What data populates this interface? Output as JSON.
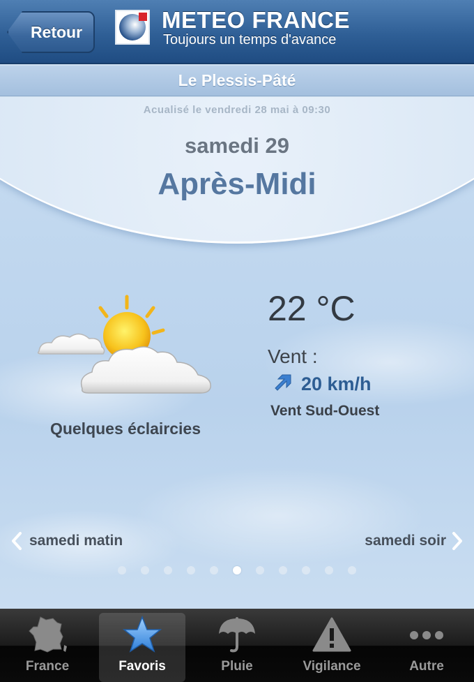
{
  "header": {
    "back_label": "Retour",
    "brand_title": "METEO FRANCE",
    "brand_tagline": "Toujours un temps d'avance"
  },
  "city": "Le Plessis-Pâté",
  "updated": "Acualisé le vendredi 28 mai à 09:30",
  "forecast": {
    "day": "samedi 29",
    "period": "Après-Midi",
    "condition": "Quelques éclaircies",
    "condition_icon": "sun-behind-clouds-icon",
    "temperature": "22 °C",
    "wind_label": "Vent :",
    "wind_speed": "20 km/h",
    "wind_direction": "Vent Sud-Ouest",
    "wind_arrow_icon": "arrow-north-east-icon"
  },
  "navigation": {
    "prev": "samedi matin",
    "next": "samedi soir",
    "page_count": 11,
    "active_page": 6
  },
  "tabs": [
    {
      "label": "France",
      "icon": "france-map-icon",
      "active": false
    },
    {
      "label": "Favoris",
      "icon": "star-icon",
      "active": true
    },
    {
      "label": "Pluie",
      "icon": "umbrella-icon",
      "active": false
    },
    {
      "label": "Vigilance",
      "icon": "warning-triangle-icon",
      "active": false
    },
    {
      "label": "Autre",
      "icon": "more-dots-icon",
      "active": false
    }
  ],
  "colors": {
    "header": "#2f5f96",
    "period_text": "#5577a0",
    "wind_speed": "#2d5d93",
    "tab_active_icon": "#3f8fe0"
  }
}
